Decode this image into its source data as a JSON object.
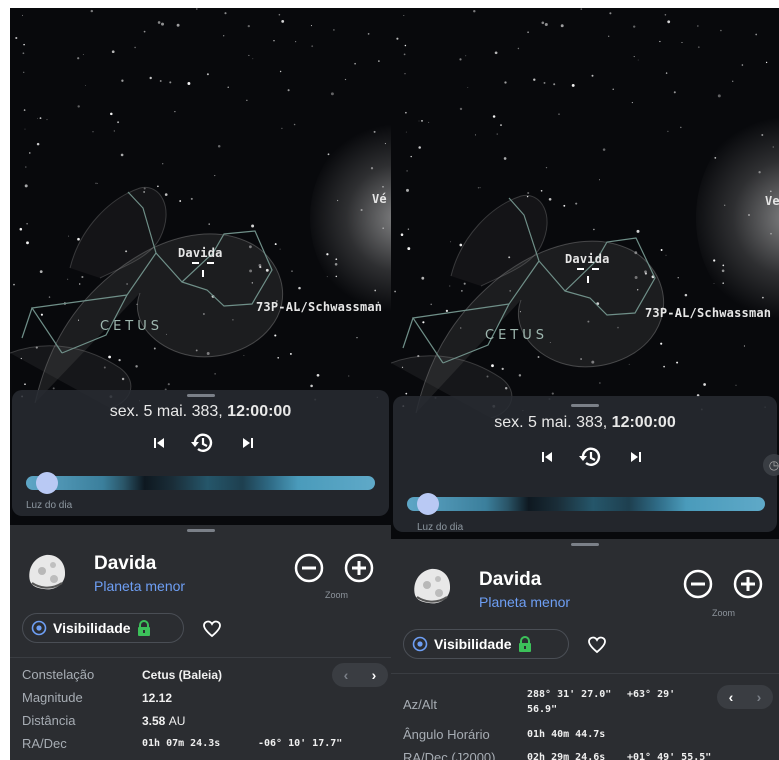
{
  "left": {
    "sky": {
      "planet_label": "Vé",
      "object_label": "Davida",
      "comet_label": "73P-AL/Schwassman",
      "constellation_label": "CETUS"
    },
    "time": {
      "date": "sex. 5 mai. 383,",
      "time": "12:00:00",
      "daylight_label": "Luz do dia",
      "daylight_position": 0.03
    },
    "object": {
      "name": "Davida",
      "type": "Planeta menor",
      "zoom_label": "Zoom",
      "visibility_label": "Visibilidade"
    },
    "rows": [
      {
        "label": "Constelação",
        "value": "Cetus (Baleia)"
      },
      {
        "label": "Magnitude",
        "value": "12.12"
      },
      {
        "label": "Distância",
        "value": "3.58",
        "unit": "AU"
      },
      {
        "label": "RA/Dec",
        "ra": "01h  07m 24.3s",
        "dec": "-06° 10' 17.7\""
      }
    ],
    "nav": {
      "prev": "‹",
      "next": "›"
    }
  },
  "right": {
    "sky": {
      "planet_label": "Ve",
      "object_label": "Davida",
      "comet_label": "73P-AL/Schwassman",
      "constellation_label": "CETUS"
    },
    "time": {
      "date": "sex. 5 mai. 383,",
      "time": "12:00:00",
      "daylight_label": "Luz do dia",
      "daylight_position": 0.03
    },
    "object": {
      "name": "Davida",
      "type": "Planeta menor",
      "zoom_label": "Zoom",
      "visibility_label": "Visibilidade"
    },
    "rows": [
      {
        "label": "Az/Alt",
        "az": "288° 31' 27.0\"",
        "alt": "+63° 29'",
        "alt2": "56.9\""
      },
      {
        "label": "Ângulo Horário",
        "value": "01h  40m 44.7s"
      },
      {
        "label": "RA/Dec (J2000)",
        "ra": "02h  29m 24.6s",
        "dec": "+01° 49' 55.5\""
      }
    ],
    "nav": {
      "prev": "‹",
      "next": "›"
    }
  },
  "colors": {
    "accent": "#6e9ff5",
    "lock": "#3cc15a",
    "panel": "#2b2d31",
    "sky": "#08090c"
  }
}
